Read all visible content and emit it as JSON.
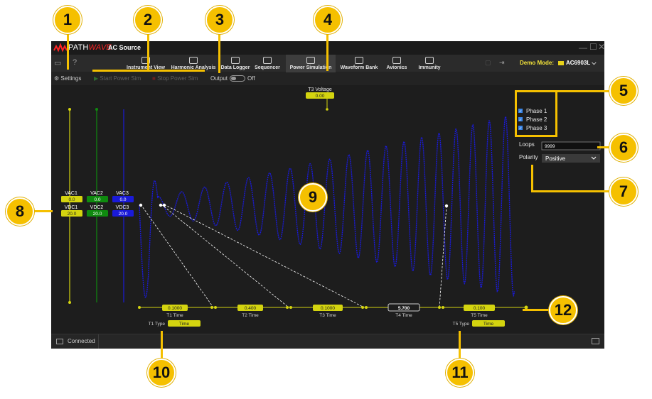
{
  "window": {
    "brand_path": "PATH",
    "brand_wave": "WAVE",
    "title": "AC Source",
    "instrument": "AC6903L",
    "demo_mode": "Demo Mode:"
  },
  "tabs": [
    {
      "label": "Instrument View",
      "active": false
    },
    {
      "label": "Harmonic Analysis",
      "active": false
    },
    {
      "label": "Data Logger",
      "active": false
    },
    {
      "label": "Sequencer",
      "active": false
    },
    {
      "label": "Power Simulation",
      "active": true
    },
    {
      "label": "Waveform Bank",
      "active": false
    },
    {
      "label": "Avionics",
      "active": false
    },
    {
      "label": "Immunity",
      "active": false
    }
  ],
  "commands": {
    "settings": "Settings",
    "start": "Start Power Sim",
    "stop": "Stop Power Sim",
    "output": "Output",
    "output_state": "Off"
  },
  "phases": {
    "phase1": "Phase 1",
    "phase2": "Phase 2",
    "phase3": "Phase 3"
  },
  "loops": {
    "label": "Loops",
    "value": "9999"
  },
  "polarity": {
    "label": "Polarity",
    "value": "Positive"
  },
  "t3_voltage": {
    "label": "T3 Voltage",
    "value": "0.00"
  },
  "ac_dc": {
    "headers": [
      "VAC1",
      "VAC2",
      "VAC3"
    ],
    "ac_values": [
      "0.0",
      "0.0",
      "0.0"
    ],
    "dc_headers": [
      "VDC1",
      "VDC2",
      "VDC3"
    ],
    "dc_values": [
      "20.0",
      "20.0",
      "20.0"
    ]
  },
  "times": [
    {
      "label": "T1 Time",
      "value": "0.1000"
    },
    {
      "label": "T2 Time",
      "value": "0.400"
    },
    {
      "label": "T3 Time",
      "value": "0.1000"
    },
    {
      "label": "T4 Time",
      "value": "5.700"
    },
    {
      "label": "T5 Time",
      "value": "0.100"
    }
  ],
  "t1_type": {
    "label": "T1 Type",
    "value": "Time"
  },
  "t5_type": {
    "label": "T5 Type",
    "value": "Time"
  },
  "status": {
    "connection": "Connected"
  },
  "callouts": [
    "1",
    "2",
    "3",
    "4",
    "5",
    "6",
    "7",
    "8",
    "9",
    "10",
    "11",
    "12"
  ],
  "colors": {
    "accent_yellow": "#d4d40f",
    "phase_green": "#0f8a0f",
    "phase_blue": "#1a1ad8",
    "callout": "#f5c000"
  }
}
